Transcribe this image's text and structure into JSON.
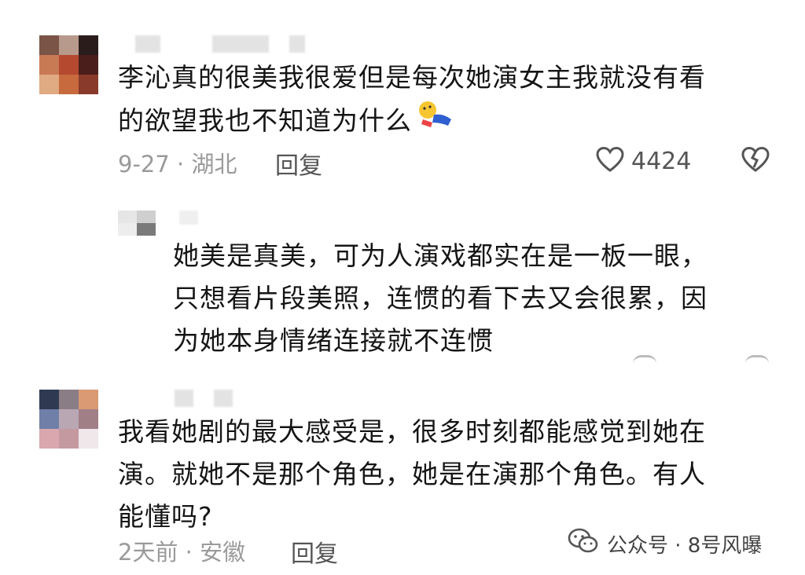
{
  "comment1": {
    "line1": "李沁真的很美我很爱但是每次她演女主我就没有看",
    "line2": "的欲望我也不知道为什么",
    "emoji": "face-lying-down-emoji",
    "date": "9-27",
    "location": "湖北",
    "reply_label": "回复",
    "like_count": "4424"
  },
  "reply1": {
    "line1": "她美是真美，可为人演戏都实在是一板一眼，",
    "line2": "只想看片段美照，连惯的看下去又会很累，因",
    "line3": "为她本身情绪连接就不连惯"
  },
  "comment2": {
    "line1": "我看她剧的最大感受是，很多时刻都能感觉到她在",
    "line2": "演。就她不是那个角色，她是在演那个角色。有人",
    "line3": "能懂吗?",
    "date": "2天前",
    "location": "安徽",
    "reply_label": "回复"
  },
  "watermark": {
    "label": "公众号 · 8号风曝"
  }
}
